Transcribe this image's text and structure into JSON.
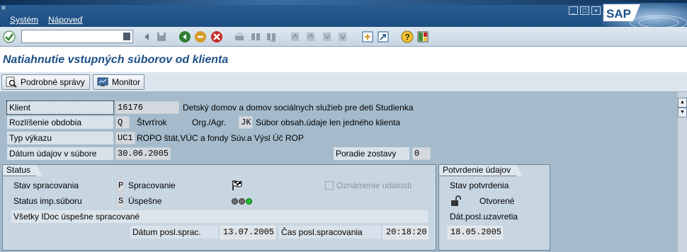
{
  "menu": {
    "system": "Systém",
    "help": "Nápoveď"
  },
  "title": "Natiahnutie vstupných súborov od klienta",
  "app_buttons": {
    "details": "Podrobné správy",
    "monitor": "Monitor"
  },
  "header": {
    "klient_label": "Klient",
    "klient_value": "16176",
    "klient_name": "Detský domov a domov sociálnych služieb pre deti Studienka",
    "rozlisenie_label": "Rozlíšenie obdobia",
    "rozlisenie_value": "Q",
    "rozlisenie_text": "Štvrťrok",
    "org_label": "Org./Agr.",
    "org_value": "JK",
    "org_text": "Súbor obsah.údaje len jedného klienta",
    "typ_label": "Typ výkazu",
    "typ_value": "UC1",
    "typ_text": "ROPO štát,VÚC a fondy Súv.a Výsl Úč ROP",
    "datum_label": "Dátum údajov v súbore",
    "datum_value": "30.06.2005",
    "poradie_label": "Poradie zostavy",
    "poradie_value": "0"
  },
  "status": {
    "title": "Status",
    "stav_label": "Stav spracovania",
    "stav_value": "P",
    "stav_text": "Spracovanie",
    "imp_label": "Status imp.súboru",
    "imp_value": "S",
    "imp_text": "Úspešne",
    "oznamenie_label": "Oznámenie udalosti",
    "message": "Všetky IDoc úspešne spracované",
    "datum_label": "Dátum posl.sprac.",
    "datum_value": "13.07.2005",
    "cas_label": "Čas posl.spracovania",
    "cas_value": "20:18:20"
  },
  "confirm": {
    "title": "Potvrdenie údajov",
    "stav_label": "Stav potvrdenia",
    "stav_text": "Otvorené",
    "dat_label": "Dát.posl.uzavretia",
    "dat_value": "18.05.2005"
  },
  "colors": {
    "title": "#1c4f86",
    "light_red": "#6d6d6d",
    "light_yellow": "#6d6d6d",
    "light_green": "#1fbf2e"
  },
  "logo": "SAP"
}
